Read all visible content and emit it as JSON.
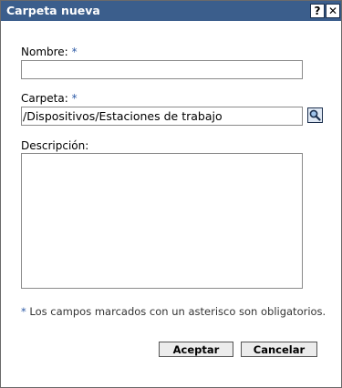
{
  "dialog": {
    "title": "Carpeta nueva",
    "help_label": "?",
    "close_label": "✕"
  },
  "form": {
    "name": {
      "label": "Nombre:",
      "required_marker": "*",
      "value": ""
    },
    "folder": {
      "label": "Carpeta:",
      "required_marker": "*",
      "value": "/Dispositivos/Estaciones de trabajo",
      "browse_icon": "search-icon"
    },
    "description": {
      "label": "Descripción:",
      "value": ""
    },
    "required_note_marker": "*",
    "required_note": "Los campos marcados con un asterisco son obligatorios."
  },
  "buttons": {
    "accept": "Aceptar",
    "cancel": "Cancelar"
  },
  "colors": {
    "titlebar": "#3b5e8c",
    "required_marker": "#2d5aa6"
  }
}
